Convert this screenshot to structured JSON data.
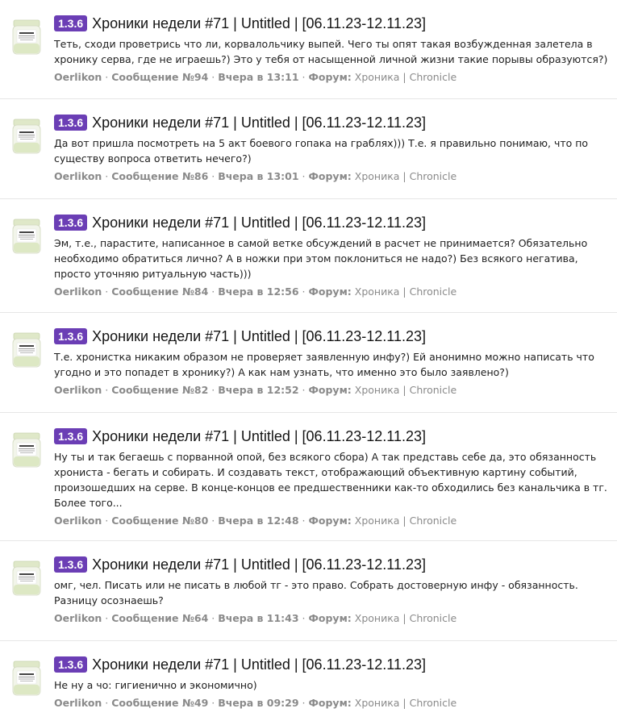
{
  "posts": [
    {
      "badge": "1.3.6",
      "title": "Хроники недели #71 | Untitled | [06.11.23-12.11.23]",
      "body": "Теть, сходи проветрись что ли, корвалольчику выпей. Чего ты опят такая возбужденная залетела в хронику серва, где не играешь?) Это у тебя от насыщенной личной жизни такие порывы образуются?)",
      "author": "Oerlikon",
      "sep": " · ",
      "message": "Сообщение №94",
      "time": "Вчера в 13:11",
      "forum_label": "Форум:",
      "forum": "Хроника | Chronicle"
    },
    {
      "badge": "1.3.6",
      "title": "Хроники недели #71 | Untitled | [06.11.23-12.11.23]",
      "body": "Да вот пришла посмотреть на 5 акт боевого гопака на граблях))) Т.е. я правильно понимаю, что по существу вопроса ответить нечего?)",
      "author": "Oerlikon",
      "sep": " · ",
      "message": "Сообщение №86",
      "time": "Вчера в 13:01",
      "forum_label": "Форум:",
      "forum": "Хроника | Chronicle"
    },
    {
      "badge": "1.3.6",
      "title": "Хроники недели #71 | Untitled | [06.11.23-12.11.23]",
      "body": "Эм, т.е., парастите, написанное в самой ветке обсуждений в расчет не принимается? Обязательно необходимо обратиться лично? А в ножки при этом поклониться не надо?) Без всякого негатива, просто уточняю ритуальную часть)))",
      "author": "Oerlikon",
      "sep": " · ",
      "message": "Сообщение №84",
      "time": "Вчера в 12:56",
      "forum_label": "Форум:",
      "forum": "Хроника | Chronicle"
    },
    {
      "badge": "1.3.6",
      "title": "Хроники недели #71 | Untitled | [06.11.23-12.11.23]",
      "body": "Т.е. хронистка никаким образом не проверяет заявленную инфу?) Ей анонимно можно написать что угодно и это попадет в хронику?) А как нам узнать, что именно это было заявлено?)",
      "author": "Oerlikon",
      "sep": " · ",
      "message": "Сообщение №82",
      "time": "Вчера в 12:52",
      "forum_label": "Форум:",
      "forum": "Хроника | Chronicle"
    },
    {
      "badge": "1.3.6",
      "title": "Хроники недели #71 | Untitled | [06.11.23-12.11.23]",
      "body": "Ну ты и так бегаешь с порванной опой, без всякого сбора) А так представь себе да, это обязанность хрониста - бегать и собирать. И создавать текст, отображающий объективную картину событий, произошедших на серве. В конце-концов ее предшественники как-то обходились без канальчика в тг. Более того...",
      "author": "Oerlikon",
      "sep": " · ",
      "message": "Сообщение №80",
      "time": "Вчера в 12:48",
      "forum_label": "Форум:",
      "forum": "Хроника | Chronicle"
    },
    {
      "badge": "1.3.6",
      "title": "Хроники недели #71 | Untitled | [06.11.23-12.11.23]",
      "body": "омг, чел. Писать или не писать в любой тг - это право. Собрать достоверную инфу - обязанность. Разницу осознаешь?",
      "author": "Oerlikon",
      "sep": " · ",
      "message": "Сообщение №64",
      "time": "Вчера в 11:43",
      "forum_label": "Форум:",
      "forum": "Хроника | Chronicle"
    },
    {
      "badge": "1.3.6",
      "title": "Хроники недели #71 | Untitled | [06.11.23-12.11.23]",
      "body": "Не ну а чо: гигиенично и экономично)",
      "author": "Oerlikon",
      "sep": " · ",
      "message": "Сообщение №49",
      "time": "Вчера в 09:29",
      "forum_label": "Форум:",
      "forum": "Хроника | Chronicle"
    }
  ]
}
